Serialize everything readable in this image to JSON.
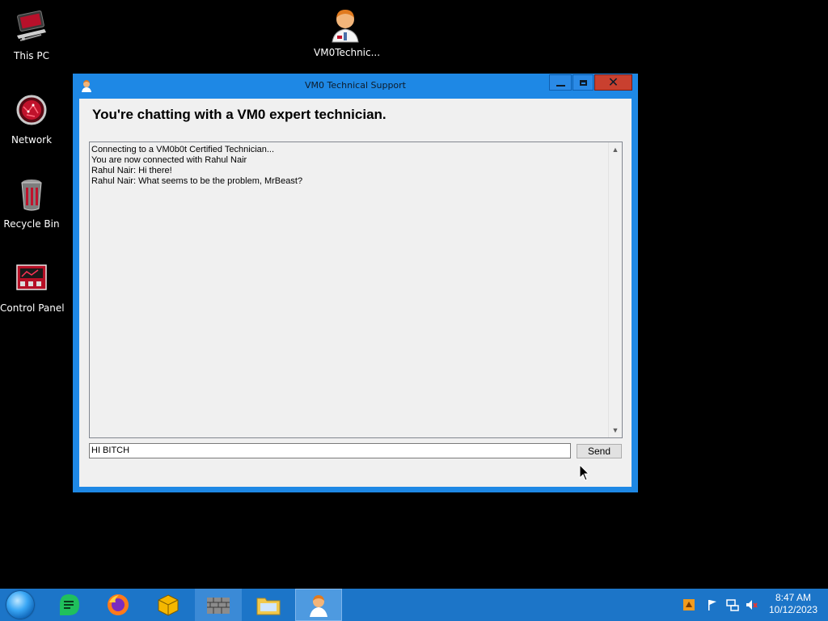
{
  "desktop": {
    "icons": [
      {
        "label": "This PC",
        "icon": "this-pc-icon"
      },
      {
        "label": "Network",
        "icon": "network-icon"
      },
      {
        "label": "Recycle Bin",
        "icon": "recycle-bin-icon"
      },
      {
        "label": "Control Panel",
        "icon": "control-panel-icon"
      },
      {
        "label": "VM0Technic...",
        "icon": "technician-icon"
      }
    ]
  },
  "window": {
    "title": "VM0 Technical Support",
    "heading": "You're chatting with a VM0 expert technician.",
    "chat_lines": [
      "Connecting to a VM0b0t Certified Technician...",
      "You are now connected with Rahul Nair",
      "Rahul Nair: Hi there!",
      "Rahul Nair: What seems to be the problem, MrBeast?"
    ],
    "input_value": "HI BITCH",
    "send_label": "Send"
  },
  "taskbar": {
    "apps": [
      "start-orb-icon",
      "notes-app-icon",
      "firefox-icon",
      "cube-app-icon",
      "wall-app-icon",
      "file-explorer-icon",
      "technical-support-icon"
    ],
    "active_app": "technical-support-icon",
    "time": "8:47 AM",
    "date": "10/12/2023"
  },
  "colors": {
    "window_border": "#1e88e5",
    "close_button": "#c9402f",
    "taskbar": "#1c75c8",
    "client_bg": "#f0f0f0"
  }
}
